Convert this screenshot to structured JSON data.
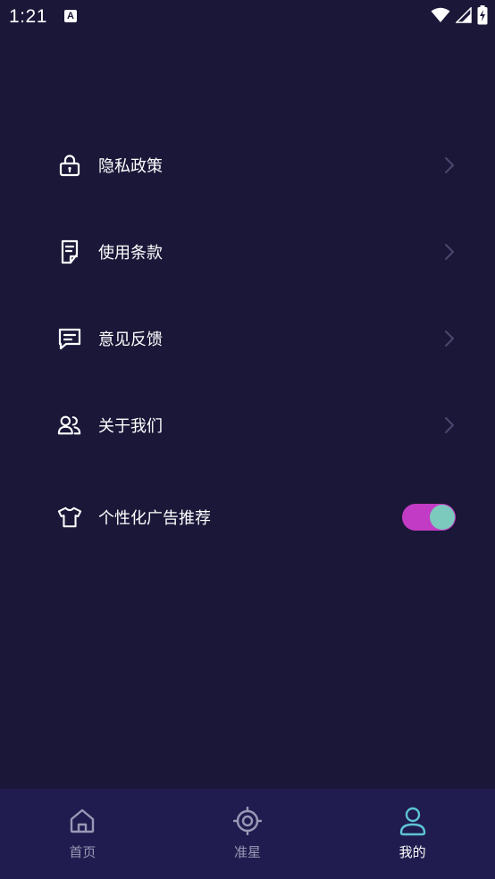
{
  "status_bar": {
    "time": "1:21",
    "notification_icon_letter": "A",
    "icons": [
      "wifi-icon",
      "signal-icon",
      "battery-charging-icon"
    ]
  },
  "menu": {
    "items": [
      {
        "label": "隐私政策",
        "icon": "lock-icon"
      },
      {
        "label": "使用条款",
        "icon": "document-icon"
      },
      {
        "label": "意见反馈",
        "icon": "feedback-icon"
      },
      {
        "label": "关于我们",
        "icon": "users-icon"
      }
    ],
    "toggle_item": {
      "label": "个性化广告推荐",
      "icon": "tshirt-icon",
      "enabled": true
    }
  },
  "bottom_nav": {
    "items": [
      {
        "label": "首页",
        "icon": "home-icon",
        "active": false
      },
      {
        "label": "准星",
        "icon": "crosshair-icon",
        "active": false
      },
      {
        "label": "我的",
        "icon": "profile-icon",
        "active": true
      }
    ]
  },
  "colors": {
    "background": "#1a1738",
    "bottom_nav_background": "#201c4f",
    "toggle_track": "#c23bc4",
    "toggle_knob": "#7cc9bd",
    "active_accent": "#5cc4d6",
    "inactive_nav": "#9a98b6",
    "chevron": "#4a4770"
  }
}
